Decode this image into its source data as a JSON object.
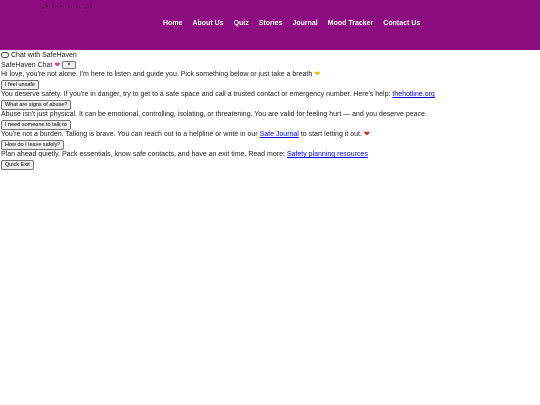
{
  "nav": {
    "items": [
      "Home",
      "About Us",
      "Quiz",
      "Stories",
      "Journal",
      "Mood Tracker",
      "Contact Us"
    ]
  },
  "chat": {
    "launcher_label": "Chat with SafeHaven",
    "title": "SafeHaven Chat",
    "close_label": "×",
    "greeting": "Hi love, you're not alone. I'm here to listen and guide you. Pick something below or just take a breath",
    "messages": [
      {
        "button": "I feel unsafe",
        "reply_before": "You deserve safety. If you're in danger, try to get to a safe space and call a trusted contact or emergency number. Here's help: ",
        "link": "thehotline.org",
        "reply_after": ""
      },
      {
        "button": "What are signs of abuse?",
        "reply_before": "Abuse isn't just physical. It can be emotional, controlling, isolating, or threatening. You are valid for feeling hurt — and you deserve peace.",
        "link": "",
        "reply_after": ""
      },
      {
        "button": "I need someone to talk to",
        "reply_before": "You're not a burden. Talking is brave. You can reach out to a helpline or write in our ",
        "link": "Safe Journal",
        "reply_after": " to start letting it out."
      },
      {
        "button": "How do I leave safely?",
        "reply_before": "Plan ahead quietly. Pack essentials, know safe contacts, and have an exit time. Read more: ",
        "link": "Safety planning resources",
        "reply_after": ""
      }
    ],
    "quick_exit_label": "Quick Exit"
  },
  "colors": {
    "header_bg": "#8b0d80",
    "nav_text": "#ffffff",
    "link": "#0000ee"
  }
}
